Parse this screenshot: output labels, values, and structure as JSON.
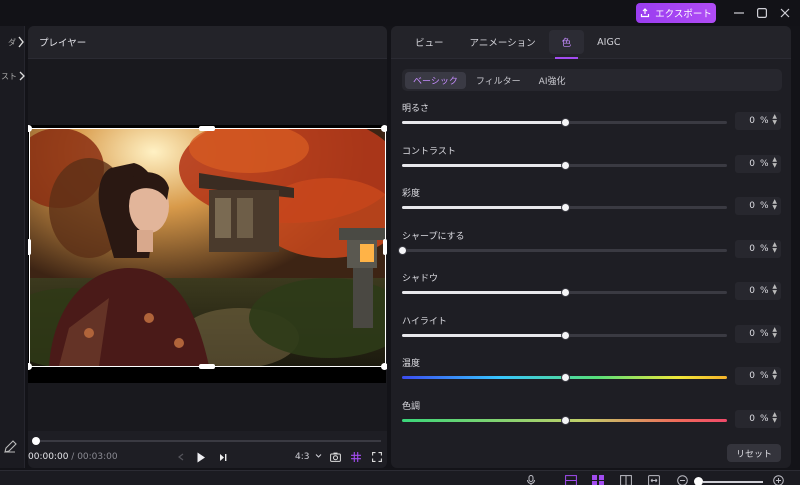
{
  "topbar": {
    "export_label": "エクスポート"
  },
  "leftstub": {
    "tab_a_label": "ダ",
    "tab_b_label": "スト"
  },
  "player": {
    "title": "プレイヤー",
    "time_current": "00:00:00",
    "time_sep": " / ",
    "time_total": "00:03:00",
    "aspect_ratio": "4:3",
    "progress": 0
  },
  "panel": {
    "tabs": [
      {
        "label": "ビュー",
        "active": false
      },
      {
        "label": "アニメーション",
        "active": false
      },
      {
        "label": "色",
        "active": true
      },
      {
        "label": "AIGC",
        "active": false
      }
    ],
    "subtabs": [
      {
        "label": "ベーシック",
        "active": true
      },
      {
        "label": "フィルター",
        "active": false
      },
      {
        "label": "AI強化",
        "active": false
      }
    ],
    "adjustments": [
      {
        "label": "明るさ",
        "value": "0",
        "unit": "%",
        "position": 0.5,
        "style": "plain"
      },
      {
        "label": "コントラスト",
        "value": "0",
        "unit": "%",
        "position": 0.5,
        "style": "plain"
      },
      {
        "label": "彩度",
        "value": "0",
        "unit": "%",
        "position": 0.5,
        "style": "plain"
      },
      {
        "label": "シャープにする",
        "value": "0",
        "unit": "%",
        "position": 0.0,
        "style": "plain"
      },
      {
        "label": "シャドウ",
        "value": "0",
        "unit": "%",
        "position": 0.5,
        "style": "plain"
      },
      {
        "label": "ハイライト",
        "value": "0",
        "unit": "%",
        "position": 0.5,
        "style": "plain"
      },
      {
        "label": "温度",
        "value": "0",
        "unit": "%",
        "position": 0.5,
        "style": "temperature"
      },
      {
        "label": "色調",
        "value": "0",
        "unit": "%",
        "position": 0.5,
        "style": "tint"
      }
    ],
    "reset_label": "リセット"
  },
  "colors": {
    "accent": "#a24cf0",
    "panel_bg": "#1e1e24",
    "app_bg": "#131318"
  }
}
